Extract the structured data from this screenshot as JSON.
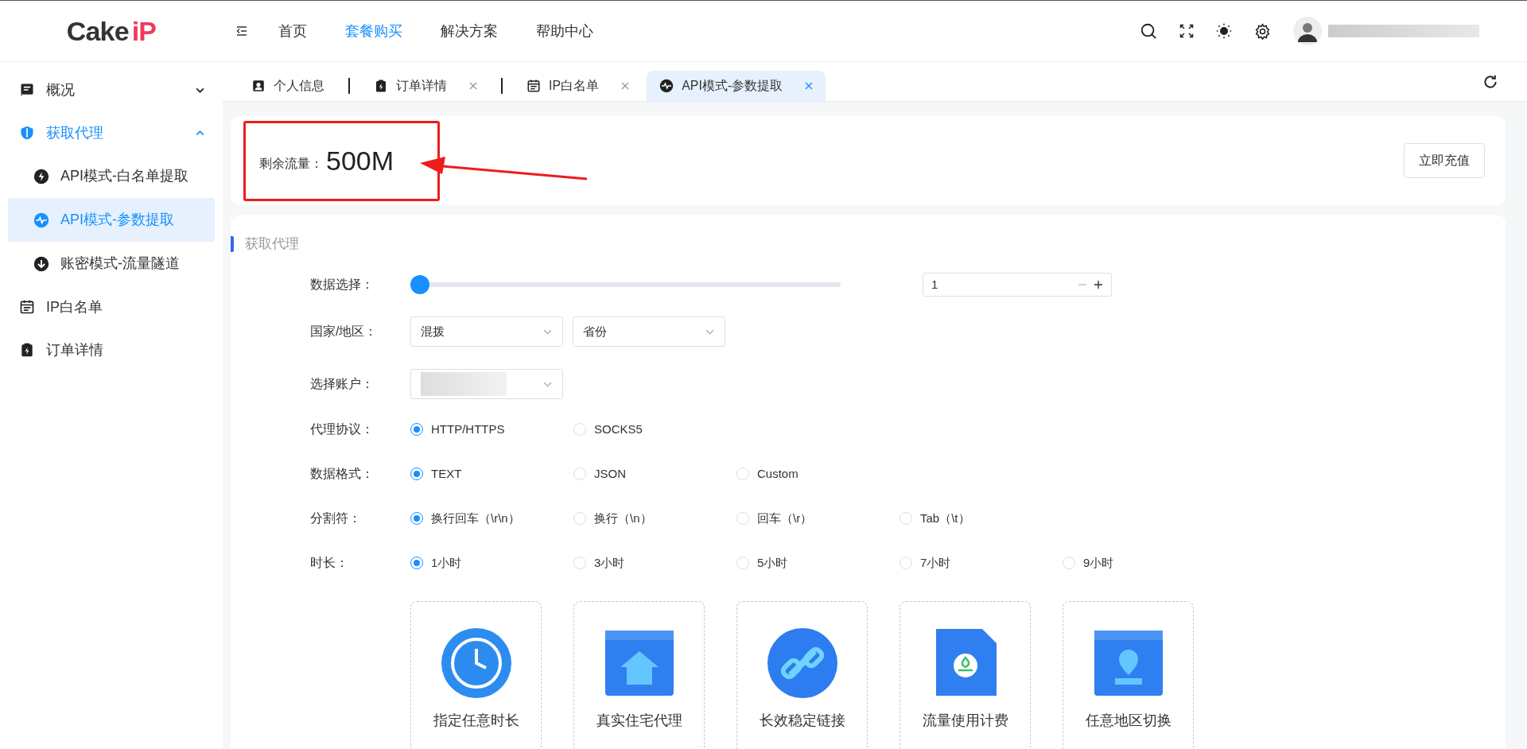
{
  "header": {
    "logo": {
      "text": "Cake",
      "accent": "iP"
    },
    "nav": [
      {
        "label": "首页",
        "selected": false
      },
      {
        "label": "套餐购买",
        "selected": true
      },
      {
        "label": "解决方案",
        "selected": false
      },
      {
        "label": "帮助中心",
        "selected": false
      }
    ]
  },
  "sidebar": {
    "items": [
      {
        "label": "概况",
        "expanded": false,
        "selected": false
      },
      {
        "label": "获取代理",
        "expanded": true,
        "selected": true,
        "children": [
          {
            "label": "API模式-白名单提取",
            "selected": false
          },
          {
            "label": "API模式-参数提取",
            "selected": true
          },
          {
            "label": "账密模式-流量隧道",
            "selected": false
          }
        ]
      },
      {
        "label": "IP白名单",
        "selected": false
      },
      {
        "label": "订单详情",
        "selected": false
      }
    ]
  },
  "tabs": [
    {
      "label": "个人信息",
      "closable": false,
      "selected": false
    },
    {
      "label": "订单详情",
      "closable": true,
      "selected": false
    },
    {
      "label": "IP白名单",
      "closable": true,
      "selected": false
    },
    {
      "label": "API模式-参数提取",
      "closable": true,
      "selected": true
    }
  ],
  "balance": {
    "label": "剩余流量：",
    "value": "500M",
    "button": "立即充值"
  },
  "section": {
    "title": "获取代理",
    "slider": {
      "label": "数据选择：",
      "level": 0,
      "value": "1"
    },
    "region": {
      "label": "国家/地区：",
      "selects": [
        "混拨",
        "省份"
      ]
    },
    "account": {
      "label": "选择账户："
    },
    "radio_groups": [
      {
        "label": "代理协议：",
        "options": [
          {
            "label": "HTTP/HTTPS",
            "selected": true
          },
          {
            "label": "SOCKS5",
            "selected": false
          }
        ]
      },
      {
        "label": "数据格式：",
        "options": [
          {
            "label": "TEXT",
            "selected": true
          },
          {
            "label": "JSON",
            "selected": false
          },
          {
            "label": "Custom",
            "selected": false
          }
        ]
      },
      {
        "label": "分割符：",
        "options": [
          {
            "label": "换行回车（\\r\\n）",
            "selected": true
          },
          {
            "label": "换行（\\n）",
            "selected": false
          },
          {
            "label": "回车（\\r）",
            "selected": false
          },
          {
            "label": "Tab（\\t）",
            "selected": false
          }
        ]
      },
      {
        "label": "时长：",
        "options": [
          {
            "label": "1小时",
            "selected": true
          },
          {
            "label": "3小时",
            "selected": false
          },
          {
            "label": "5小时",
            "selected": false
          },
          {
            "label": "7小时",
            "selected": false
          },
          {
            "label": "9小时",
            "selected": false
          }
        ]
      }
    ],
    "features": [
      {
        "label": "指定任意时长",
        "kind": "clock"
      },
      {
        "label": "真实住宅代理",
        "kind": "house"
      },
      {
        "label": "长效稳定链接",
        "kind": "link"
      },
      {
        "label": "流量使用计费",
        "kind": "meter"
      },
      {
        "label": "任意地区切换",
        "kind": "pin"
      }
    ]
  }
}
